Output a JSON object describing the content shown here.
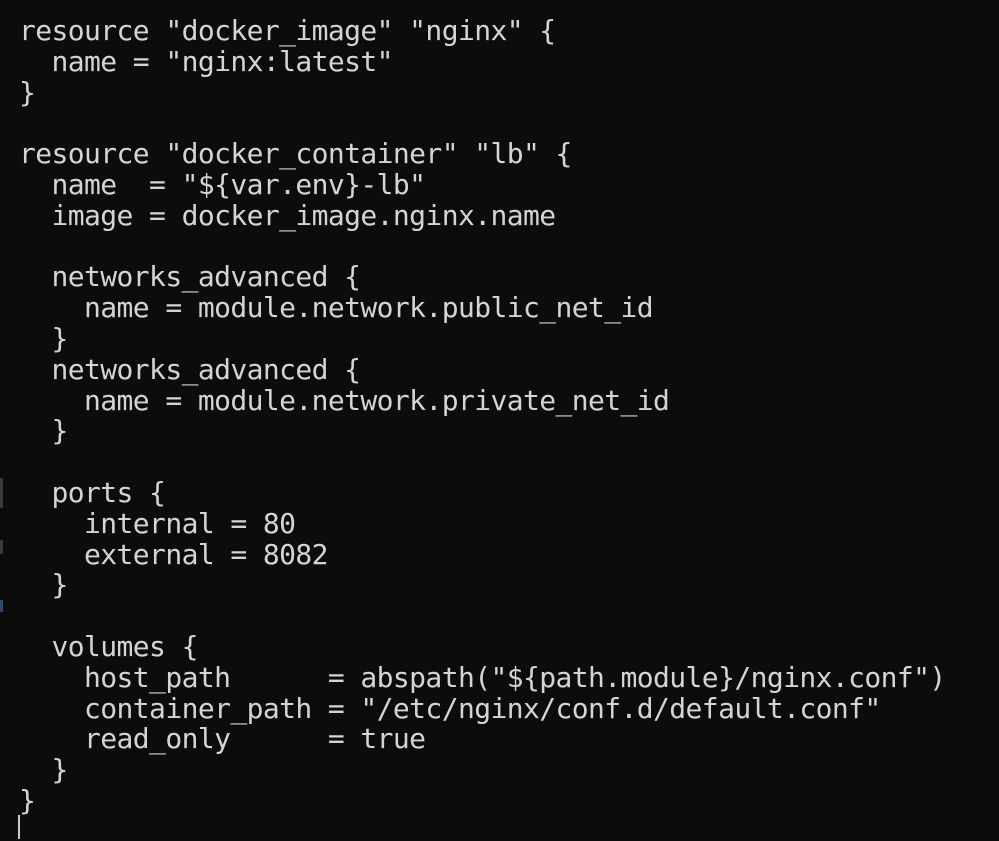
{
  "terminal": {
    "lines": [
      "resource \"docker_image\" \"nginx\" {",
      "  name = \"nginx:latest\"",
      "}",
      "",
      "resource \"docker_container\" \"lb\" {",
      "  name  = \"${var.env}-lb\"",
      "  image = docker_image.nginx.name",
      "",
      "  networks_advanced {",
      "    name = module.network.public_net_id",
      "  }",
      "  networks_advanced {",
      "    name = module.network.private_net_id",
      "  }",
      "",
      "  ports {",
      "    internal = 80",
      "    external = 8082",
      "  }",
      "",
      "  volumes {",
      "    host_path      = abspath(\"${path.module}/nginx.conf\")",
      "    container_path = \"/etc/nginx/conf.d/default.conf\"",
      "    read_only      = true",
      "  }",
      "}"
    ],
    "colors": {
      "background": "#0c0c0c",
      "text": "#d4d4d4",
      "cursor": "#cccccc"
    }
  }
}
